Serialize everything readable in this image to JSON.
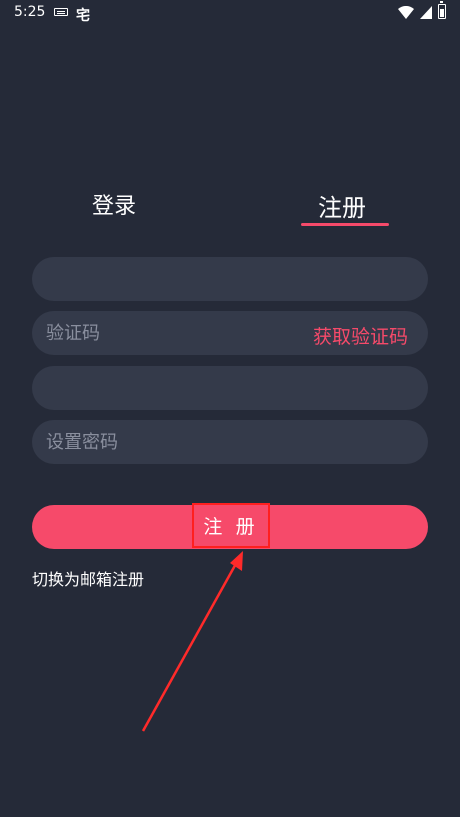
{
  "status_bar": {
    "time": "5:25",
    "app_glyph": "宅",
    "icons": [
      "keyboard-icon",
      "wifi-icon",
      "signal-icon",
      "battery-icon"
    ]
  },
  "tabs": {
    "login": "登录",
    "register": "注册",
    "active": "register"
  },
  "form": {
    "field1_placeholder": "",
    "code_placeholder": "验证码",
    "get_code_label": "获取验证码",
    "field3_placeholder": "",
    "password_placeholder": "设置密码"
  },
  "submit_label": "注 册",
  "switch_link": "切换为邮箱注册",
  "colors": {
    "background": "#252a38",
    "field": "#343a4a",
    "accent": "#f64a6a",
    "annotation": "#ff1f1f"
  }
}
